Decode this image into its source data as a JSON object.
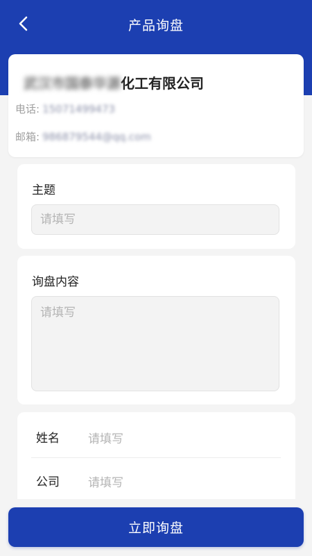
{
  "header": {
    "title": "产品询盘"
  },
  "company": {
    "name_blurred": "武汉市国泰华源",
    "name_suffix": "化工有限公司",
    "phone_label": "电话:",
    "phone_value": "15071499473",
    "email_label": "邮箱:",
    "email_value": "986879544@qq.com"
  },
  "form": {
    "subject_label": "主题",
    "subject_placeholder": "请填写",
    "content_label": "询盘内容",
    "content_placeholder": "请填写",
    "name_label": "姓名",
    "name_placeholder": "请填写",
    "company_label": "公司",
    "company_placeholder": "请填写"
  },
  "actions": {
    "submit_label": "立即询盘"
  },
  "colors": {
    "primary": "#1c3fb1",
    "background": "#f4f4f4",
    "placeholder": "#b4b4b4"
  }
}
